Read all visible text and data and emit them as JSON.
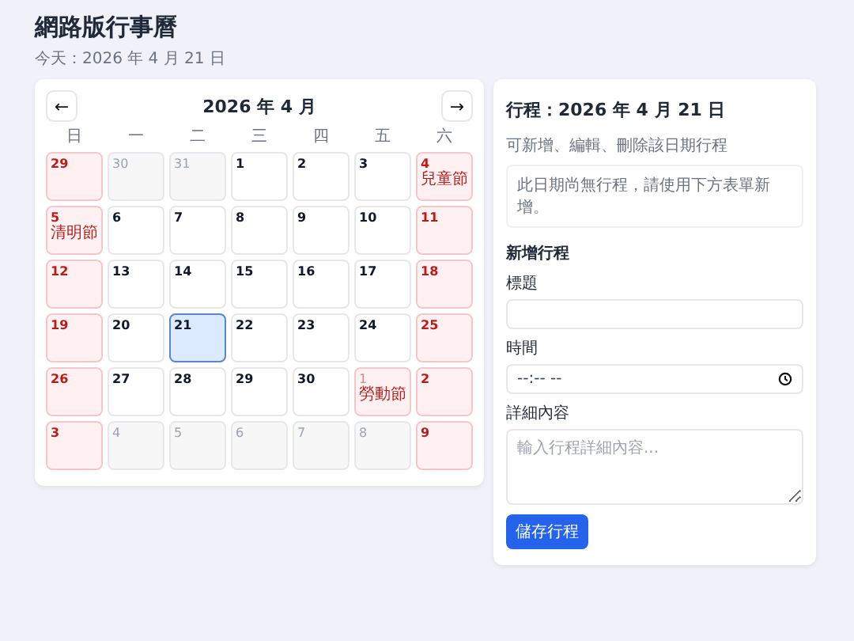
{
  "page": {
    "title": "網路版行事曆",
    "today": "今天：2026 年 4 月 21 日"
  },
  "calendar": {
    "prev_button": "←",
    "month_title": "2026 年 4 月",
    "next_button": "→",
    "weekdays": [
      "日",
      "一",
      "二",
      "三",
      "四",
      "五",
      "六"
    ],
    "days": [
      {
        "day": "29",
        "muted": false,
        "rest": true,
        "selected": false
      },
      {
        "day": "30",
        "muted": true,
        "rest": false,
        "selected": false
      },
      {
        "day": "31",
        "muted": true,
        "rest": false,
        "selected": false
      },
      {
        "day": "1",
        "muted": false,
        "rest": false,
        "selected": false
      },
      {
        "day": "2",
        "muted": false,
        "rest": false,
        "selected": false
      },
      {
        "day": "3",
        "muted": false,
        "rest": false,
        "selected": false
      },
      {
        "day": "4",
        "muted": false,
        "rest": true,
        "selected": false,
        "note": "兒童節"
      },
      {
        "day": "5",
        "muted": false,
        "rest": true,
        "selected": false,
        "note": "清明節"
      },
      {
        "day": "6",
        "muted": false,
        "rest": false,
        "selected": false
      },
      {
        "day": "7",
        "muted": false,
        "rest": false,
        "selected": false
      },
      {
        "day": "8",
        "muted": false,
        "rest": false,
        "selected": false
      },
      {
        "day": "9",
        "muted": false,
        "rest": false,
        "selected": false
      },
      {
        "day": "10",
        "muted": false,
        "rest": false,
        "selected": false
      },
      {
        "day": "11",
        "muted": false,
        "rest": true,
        "selected": false
      },
      {
        "day": "12",
        "muted": false,
        "rest": true,
        "selected": false
      },
      {
        "day": "13",
        "muted": false,
        "rest": false,
        "selected": false
      },
      {
        "day": "14",
        "muted": false,
        "rest": false,
        "selected": false
      },
      {
        "day": "15",
        "muted": false,
        "rest": false,
        "selected": false
      },
      {
        "day": "16",
        "muted": false,
        "rest": false,
        "selected": false
      },
      {
        "day": "17",
        "muted": false,
        "rest": false,
        "selected": false
      },
      {
        "day": "18",
        "muted": false,
        "rest": true,
        "selected": false
      },
      {
        "day": "19",
        "muted": false,
        "rest": true,
        "selected": false
      },
      {
        "day": "20",
        "muted": false,
        "rest": false,
        "selected": false
      },
      {
        "day": "21",
        "muted": false,
        "rest": false,
        "selected": true
      },
      {
        "day": "22",
        "muted": false,
        "rest": false,
        "selected": false
      },
      {
        "day": "23",
        "muted": false,
        "rest": false,
        "selected": false
      },
      {
        "day": "24",
        "muted": false,
        "rest": false,
        "selected": false
      },
      {
        "day": "25",
        "muted": false,
        "rest": true,
        "selected": false
      },
      {
        "day": "26",
        "muted": false,
        "rest": true,
        "selected": false
      },
      {
        "day": "27",
        "muted": false,
        "rest": false,
        "selected": false
      },
      {
        "day": "28",
        "muted": false,
        "rest": false,
        "selected": false
      },
      {
        "day": "29",
        "muted": false,
        "rest": false,
        "selected": false
      },
      {
        "day": "30",
        "muted": false,
        "rest": false,
        "selected": false
      },
      {
        "day": "1",
        "muted": true,
        "rest": true,
        "selected": false,
        "note": "勞動節"
      },
      {
        "day": "2",
        "muted": false,
        "rest": true,
        "selected": false
      },
      {
        "day": "3",
        "muted": false,
        "rest": true,
        "selected": false
      },
      {
        "day": "4",
        "muted": true,
        "rest": false,
        "selected": false
      },
      {
        "day": "5",
        "muted": true,
        "rest": false,
        "selected": false
      },
      {
        "day": "6",
        "muted": true,
        "rest": false,
        "selected": false
      },
      {
        "day": "7",
        "muted": true,
        "rest": false,
        "selected": false
      },
      {
        "day": "8",
        "muted": true,
        "rest": false,
        "selected": false
      },
      {
        "day": "9",
        "muted": false,
        "rest": true,
        "selected": false
      }
    ]
  },
  "panel": {
    "title": "行程：2026 年 4 月 21 日",
    "subtitle": "可新增、編輯、刪除該日期行程",
    "empty_message": "此日期尚無行程，請使用下方表單新增。",
    "form_title": "新增行程",
    "fields": [
      {
        "kind": "text",
        "label": "標題"
      },
      {
        "kind": "time",
        "label": "時間",
        "value": "--:-- --"
      },
      {
        "kind": "textarea",
        "label": "詳細內容",
        "placeholder": "輸入行程詳細內容..."
      }
    ],
    "save_button": "儲存行程"
  }
}
